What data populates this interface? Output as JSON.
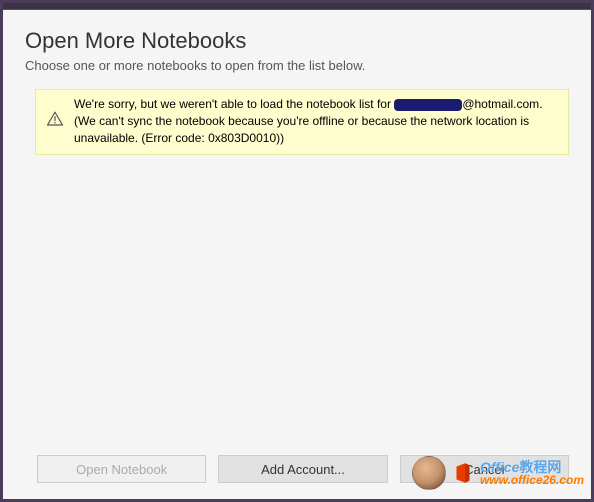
{
  "dialog": {
    "title": "Open More Notebooks",
    "subtitle": "Choose one or more notebooks to open from the list below."
  },
  "warning": {
    "text_before": "We're sorry, but we weren't able to load the notebook list for ",
    "email_suffix": "@hotmail.com",
    "text_after": ". (We can't sync the notebook because you're offline or because the network location is unavailable. (Error code: 0x803D0010))"
  },
  "buttons": {
    "open": "Open Notebook",
    "add_account": "Add Account...",
    "cancel": "Cancel"
  },
  "watermark": {
    "brand": "Office",
    "brand_cn": "教程网",
    "url": "www.office26.com"
  }
}
